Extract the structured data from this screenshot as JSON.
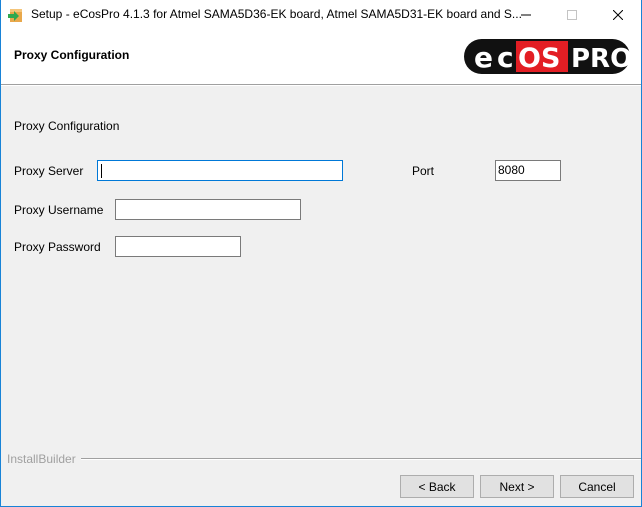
{
  "window": {
    "title": "Setup - eCosPro 4.1.3 for Atmel SAMA5D36-EK board, Atmel SAMA5D31-EK board and S...",
    "icon": "installer-box-arrow-icon",
    "controls": {
      "minimize": "—",
      "maximize": "☐",
      "close": "✕",
      "maximize_enabled": false
    }
  },
  "header": {
    "title": "Proxy Configuration",
    "logo": {
      "parts": [
        "e",
        "c",
        "OS",
        "PRO"
      ],
      "colors": {
        "background": "#111111",
        "accent": "#e31e24",
        "text": "#ffffff"
      }
    }
  },
  "body": {
    "section_title": "Proxy Configuration",
    "fields": {
      "proxy_server": {
        "label": "Proxy Server",
        "value": "",
        "focused": true
      },
      "port": {
        "label": "Port",
        "value": "8080"
      },
      "proxy_username": {
        "label": "Proxy Username",
        "value": ""
      },
      "proxy_password": {
        "label": "Proxy Password",
        "value": ""
      }
    }
  },
  "footer": {
    "brand": "InstallBuilder",
    "buttons": {
      "back": "< Back",
      "next": "Next >",
      "cancel": "Cancel"
    }
  },
  "colors": {
    "accent": "#0078d7",
    "window_border": "#1883d7",
    "background": "#f0f0f0"
  }
}
